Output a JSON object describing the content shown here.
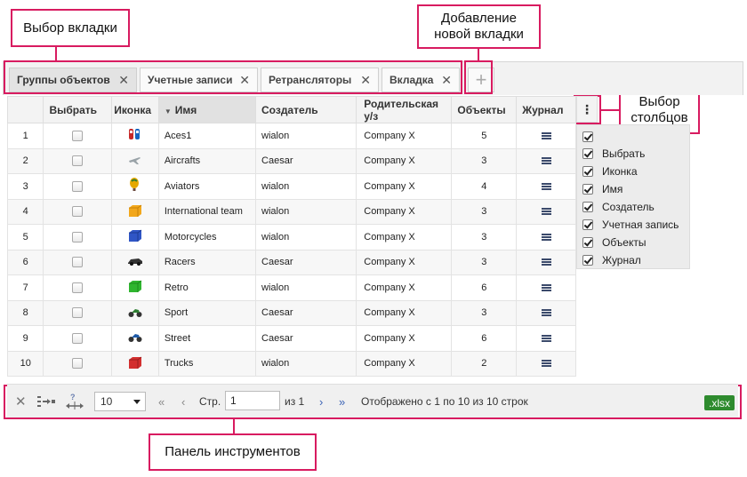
{
  "callouts": {
    "tab_select": "Выбор вкладки",
    "add_tab_line1": "Добавление",
    "add_tab_line2": "новой вкладки",
    "col_select_line1": "Выбор",
    "col_select_line2": "столбцов",
    "toolbar": "Панель инструментов"
  },
  "tabs": [
    {
      "label": "Группы объектов",
      "active": true
    },
    {
      "label": "Учетные записи",
      "active": false
    },
    {
      "label": "Ретрансляторы",
      "active": false
    },
    {
      "label": "Вкладка",
      "active": false
    }
  ],
  "add_tab_symbol": "+",
  "table": {
    "headers": {
      "select": "Выбрать",
      "icon": "Иконка",
      "name": "Имя",
      "creator": "Создатель",
      "parent": "Родительская у/з",
      "objects": "Объекты",
      "journal": "Журнал"
    },
    "sort_arrow": "▼",
    "rows": [
      {
        "n": "1",
        "name": "Aces1",
        "creator": "wialon",
        "parent": "Company X",
        "objects": "5",
        "icon": "cars-icon"
      },
      {
        "n": "2",
        "name": "Aircrafts",
        "creator": "Caesar",
        "parent": "Company X",
        "objects": "3",
        "icon": "airplane-icon"
      },
      {
        "n": "3",
        "name": "Aviators",
        "creator": "wialon",
        "parent": "Company X",
        "objects": "4",
        "icon": "balloon-icon"
      },
      {
        "n": "4",
        "name": "International team",
        "creator": "wialon",
        "parent": "Company X",
        "objects": "3",
        "icon": "yellow-truck-icon"
      },
      {
        "n": "5",
        "name": "Motorcycles",
        "creator": "wialon",
        "parent": "Company X",
        "objects": "3",
        "icon": "blue-truck-icon"
      },
      {
        "n": "6",
        "name": "Racers",
        "creator": "Caesar",
        "parent": "Company X",
        "objects": "3",
        "icon": "race-car-icon"
      },
      {
        "n": "7",
        "name": "Retro",
        "creator": "wialon",
        "parent": "Company X",
        "objects": "6",
        "icon": "green-truck-icon"
      },
      {
        "n": "8",
        "name": "Sport",
        "creator": "Caesar",
        "parent": "Company X",
        "objects": "3",
        "icon": "motorbike-icon"
      },
      {
        "n": "9",
        "name": "Street",
        "creator": "Caesar",
        "parent": "Company X",
        "objects": "6",
        "icon": "motorbike-blue-icon"
      },
      {
        "n": "10",
        "name": "Trucks",
        "creator": "wialon",
        "parent": "Company X",
        "objects": "2",
        "icon": "red-truck-icon"
      }
    ]
  },
  "column_chooser": {
    "button": "⋮",
    "items": [
      "Выбрать",
      "Иконка",
      "Имя",
      "Создатель",
      "Учетная запись",
      "Объекты",
      "Журнал"
    ]
  },
  "toolbar": {
    "page_size": "10",
    "page_label": "Стр.",
    "page_value": "1",
    "of_label": "из 1",
    "summary": "Отображено с 1 по 10 из 10 строк",
    "export": ".xlsx"
  }
}
